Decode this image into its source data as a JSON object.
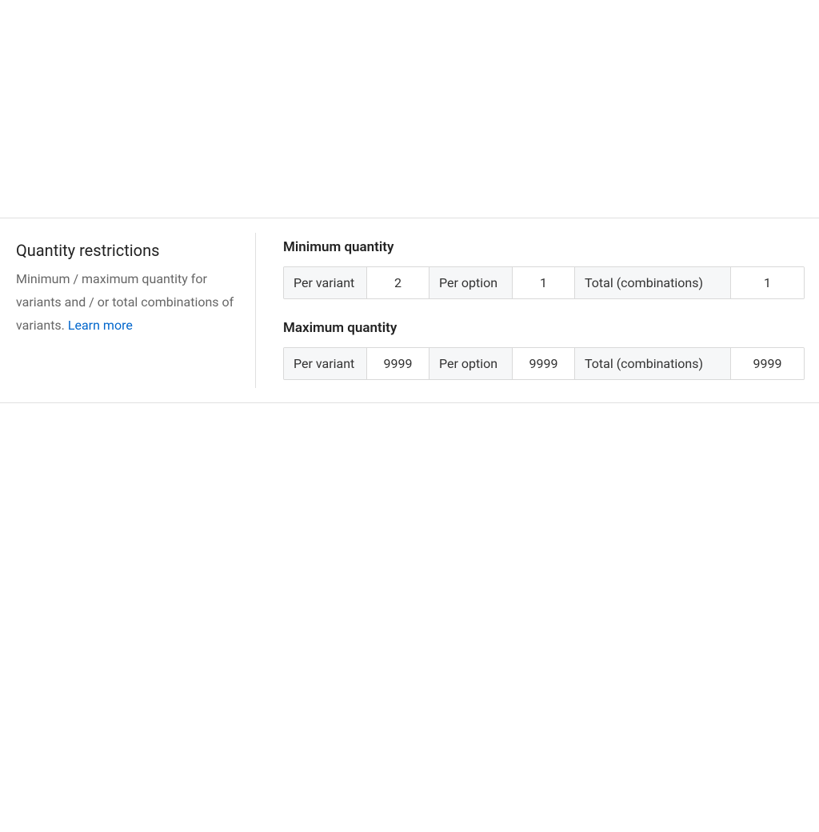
{
  "section": {
    "title": "Quantity restrictions",
    "description_pre": "Minimum / maximum quantity for variants and / or total combinations of variants. ",
    "learn_more": "Learn more"
  },
  "groups": {
    "min": {
      "heading": "Minimum quantity",
      "per_variant_label": "Per variant",
      "per_variant_value": "2",
      "per_option_label": "Per option",
      "per_option_value": "1",
      "total_label": "Total (combinations)",
      "total_value": "1"
    },
    "max": {
      "heading": "Maximum quantity",
      "per_variant_label": "Per variant",
      "per_variant_value": "9999",
      "per_option_label": "Per option",
      "per_option_value": "9999",
      "total_label": "Total (combinations)",
      "total_value": "9999"
    }
  }
}
